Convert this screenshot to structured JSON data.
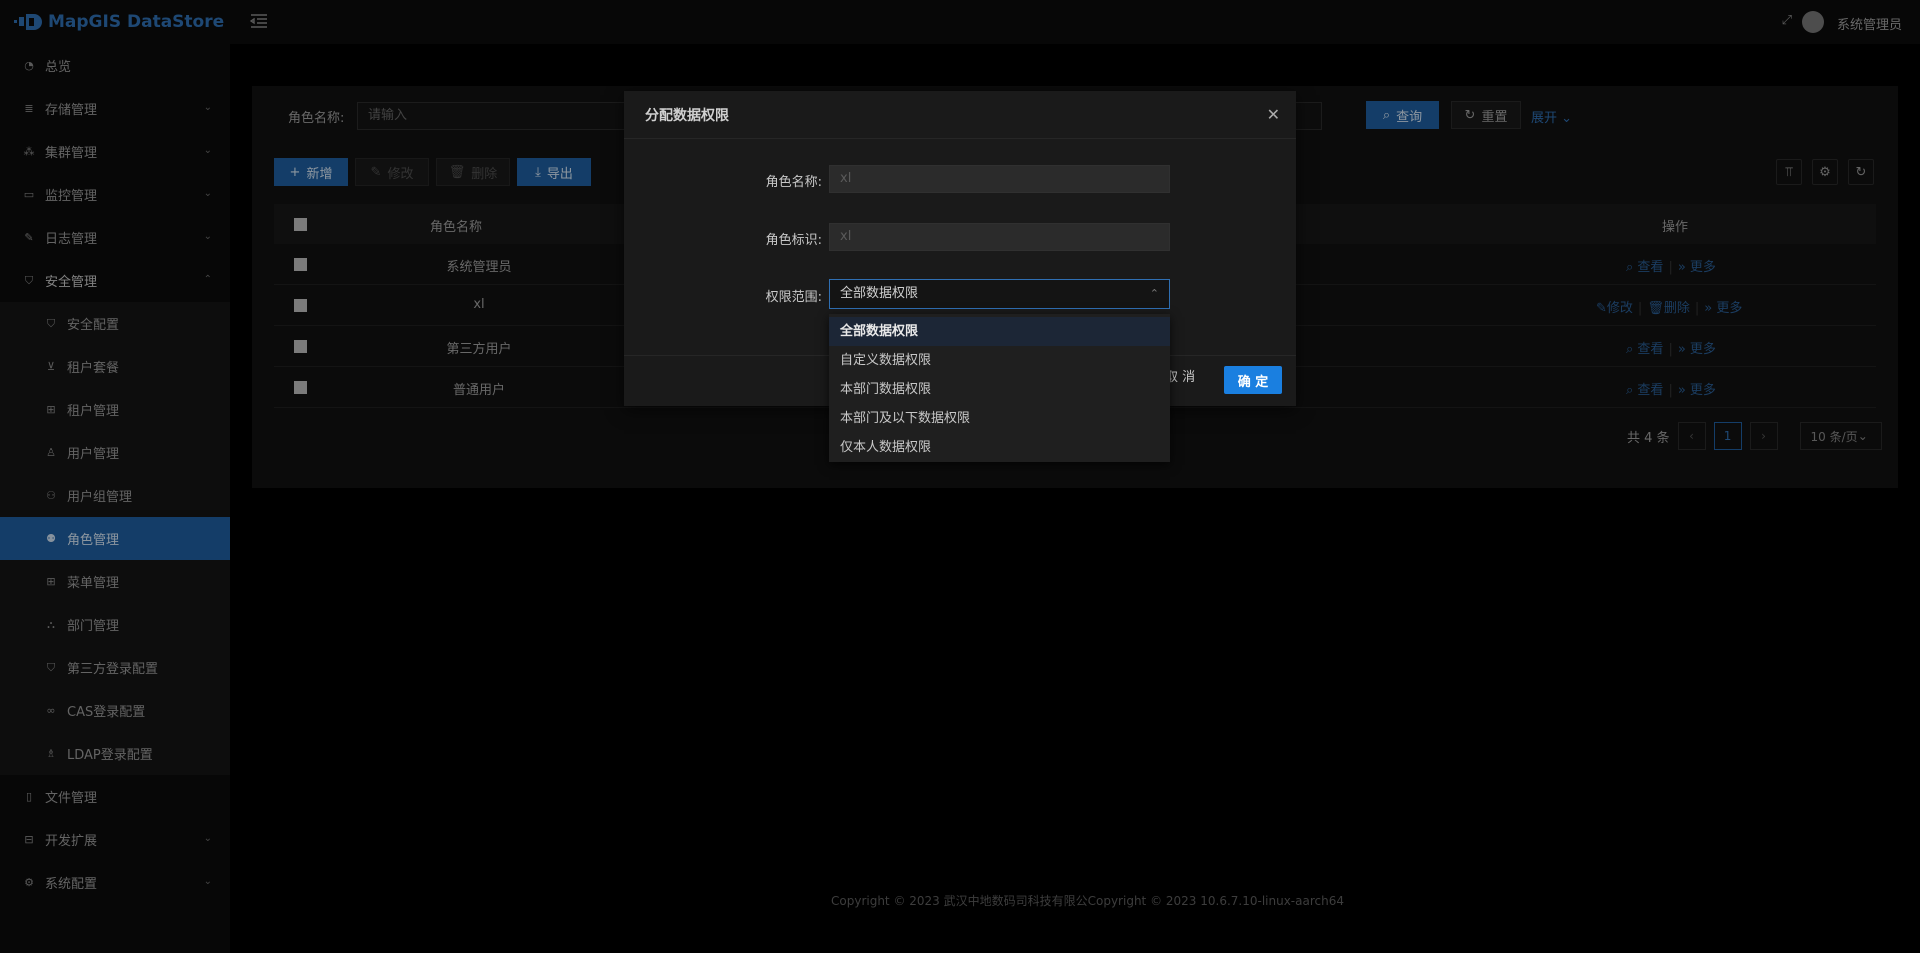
{
  "app": {
    "logo_text": "MapGIS DataStore"
  },
  "sidebar": {
    "items": [
      {
        "label": "总览",
        "icon": "dashboard-icon"
      },
      {
        "label": "存储管理",
        "icon": "storage-icon",
        "chevron": "⌄"
      },
      {
        "label": "集群管理",
        "icon": "cluster-icon",
        "chevron": "⌄"
      },
      {
        "label": "监控管理",
        "icon": "monitor-icon",
        "chevron": "⌄"
      },
      {
        "label": "日志管理",
        "icon": "log-icon",
        "chevron": "⌄"
      },
      {
        "label": "安全管理",
        "icon": "shield-icon",
        "chevron": "⌃"
      }
    ],
    "security_sub": [
      {
        "label": "安全配置"
      },
      {
        "label": "租户套餐"
      },
      {
        "label": "租户管理"
      },
      {
        "label": "用户管理"
      },
      {
        "label": "用户组管理"
      },
      {
        "label": "角色管理"
      },
      {
        "label": "菜单管理"
      },
      {
        "label": "部门管理"
      },
      {
        "label": "第三方登录配置"
      },
      {
        "label": "CAS登录配置"
      },
      {
        "label": "LDAP登录配置"
      }
    ],
    "bottom": [
      {
        "label": "文件管理"
      },
      {
        "label": "开发扩展",
        "chevron": "⌄"
      },
      {
        "label": "系统配置",
        "chevron": "⌄"
      }
    ]
  },
  "topbar": {
    "username": "系统管理员"
  },
  "search": {
    "role_name_label": "角色名称:",
    "role_name_placeholder": "请输入",
    "query_label": "查询",
    "reset_label": "重置",
    "expand_label": "展开"
  },
  "toolbar": {
    "add_label": "新增",
    "edit_label": "修改",
    "delete_label": "删除",
    "export_label": "导出"
  },
  "table": {
    "col_name": "角色名称",
    "col_ops": "操作",
    "rows": [
      {
        "name": "系统管理员",
        "actions": [
          "查看",
          "更多"
        ]
      },
      {
        "name": "xl",
        "actions": [
          "修改",
          "删除",
          "更多"
        ]
      },
      {
        "name": "第三方用户",
        "actions": [
          "查看",
          "更多"
        ]
      },
      {
        "name": "普通用户",
        "actions": [
          "查看",
          "更多"
        ]
      }
    ]
  },
  "pagination": {
    "total": "共 4 条",
    "current": "1",
    "page_size": "10 条/页"
  },
  "footer": {
    "text": "Copyright © 2023 武汉中地数码司科技有限公Copyright © 2023 10.6.7.10-linux-aarch64"
  },
  "modal": {
    "title": "分配数据权限",
    "role_name_label": "角色名称:",
    "role_name_value": "xl",
    "role_key_label": "角色标识:",
    "role_key_value": "xl",
    "scope_label": "权限范围:",
    "scope_value": "全部数据权限",
    "cancel_label": "取 消",
    "ok_label": "确 定",
    "options": [
      "全部数据权限",
      "自定义数据权限",
      "本部门数据权限",
      "本部门及以下数据权限",
      "仅本人数据权限"
    ]
  },
  "colors": {
    "primary": "#1f5fa0",
    "accent": "#1a7fe0",
    "link": "#2f6fb3"
  }
}
